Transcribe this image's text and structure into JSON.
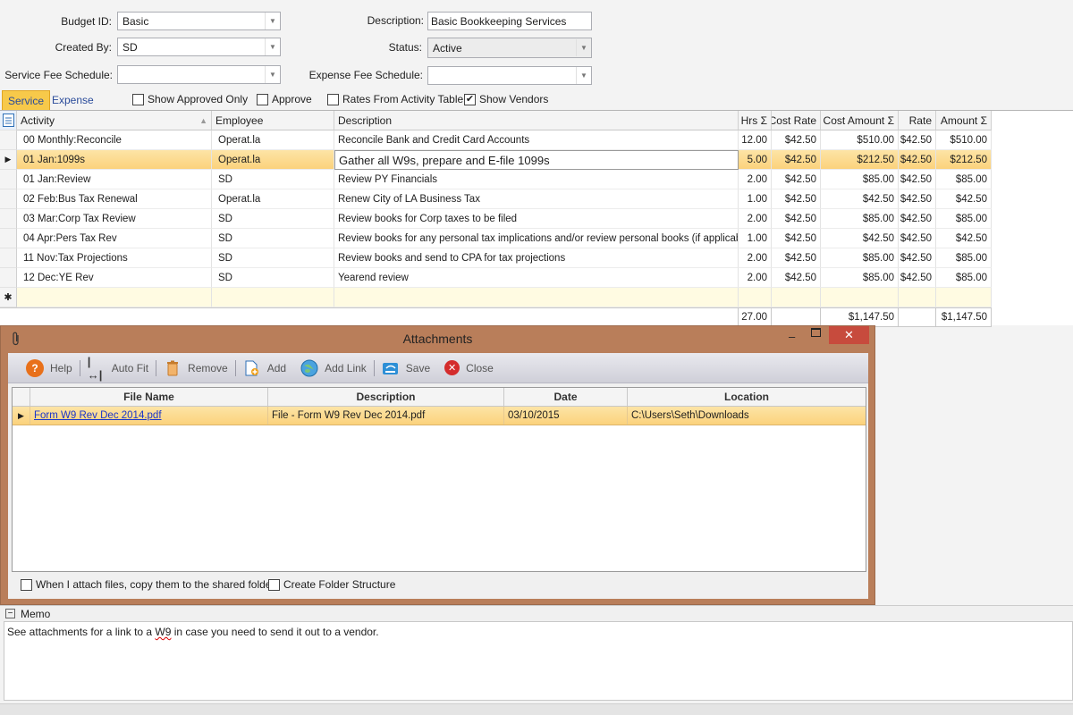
{
  "form": {
    "budget_id_label": "Budget ID:",
    "budget_id_value": "Basic",
    "created_by_label": "Created By:",
    "created_by_value": "SD",
    "service_fee_label": "Service Fee Schedule:",
    "service_fee_value": "",
    "description_label": "Description:",
    "description_value": "Basic Bookkeeping Services",
    "status_label": "Status:",
    "status_value": "Active",
    "expense_fee_label": "Expense Fee Schedule:",
    "expense_fee_value": ""
  },
  "tabs": {
    "service": "Service",
    "expense": "Expense"
  },
  "options": [
    {
      "label": "Show Approved Only",
      "checked": false
    },
    {
      "label": "Approve",
      "checked": false
    },
    {
      "label": "Rates From Activity Table",
      "checked": false
    },
    {
      "label": "Show Vendors",
      "checked": true
    }
  ],
  "grid": {
    "columns": [
      "Activity",
      "Employee",
      "Description",
      "Hrs",
      "Cost Rate",
      "Cost Amount",
      "Rate",
      "Amount"
    ],
    "rows": [
      [
        "00 Monthly:Reconcile",
        "Operat.la",
        "Reconcile Bank and Credit Card Accounts",
        "12.00",
        "$42.50",
        "$510.00",
        "$42.50",
        "$510.00"
      ],
      [
        "01 Jan:1099s",
        "Operat.la",
        "Gather all W9s, prepare and E-file 1099s",
        "5.00",
        "$42.50",
        "$212.50",
        "$42.50",
        "$212.50"
      ],
      [
        "01 Jan:Review",
        "SD",
        "Review PY Financials",
        "2.00",
        "$42.50",
        "$85.00",
        "$42.50",
        "$85.00"
      ],
      [
        "02 Feb:Bus Tax Renewal",
        "Operat.la",
        "Renew City of LA Business Tax",
        "1.00",
        "$42.50",
        "$42.50",
        "$42.50",
        "$42.50"
      ],
      [
        "03 Mar:Corp Tax Review",
        "SD",
        "Review books for Corp taxes to be filed",
        "2.00",
        "$42.50",
        "$85.00",
        "$42.50",
        "$85.00"
      ],
      [
        "04 Apr:Pers Tax Rev",
        "SD",
        "Review books for any personal tax implications and/or review personal books (if applicable)",
        "1.00",
        "$42.50",
        "$42.50",
        "$42.50",
        "$42.50"
      ],
      [
        "11 Nov:Tax Projections",
        "SD",
        "Review books and send to CPA for tax projections",
        "2.00",
        "$42.50",
        "$85.00",
        "$42.50",
        "$85.00"
      ],
      [
        "12 Dec:YE Rev",
        "SD",
        "Yearend review",
        "2.00",
        "$42.50",
        "$85.00",
        "$42.50",
        "$85.00"
      ]
    ],
    "selected_index": 1,
    "totals": {
      "hrs": "27.00",
      "cost_amount": "$1,147.50",
      "amount": "$1,147.50"
    }
  },
  "attachments": {
    "title": "Attachments",
    "toolbar": {
      "help": "Help",
      "auto_fit": "Auto Fit",
      "remove": "Remove",
      "add": "Add",
      "add_link": "Add Link",
      "save": "Save",
      "close": "Close"
    },
    "columns": [
      "File Name",
      "Description",
      "Date",
      "Location"
    ],
    "rows": [
      [
        "Form W9 Rev Dec 2014.pdf",
        "File - Form W9 Rev Dec 2014.pdf",
        "03/10/2015",
        "C:\\Users\\Seth\\Downloads"
      ]
    ],
    "copy_option": "When I attach files, copy them to the shared folder",
    "folder_option": "Create Folder Structure"
  },
  "memo": {
    "label": "Memo",
    "text_before": "See attachments for a link to a ",
    "text_squiggle": "W9",
    "text_after": " in case you need to send it out to a vendor."
  }
}
